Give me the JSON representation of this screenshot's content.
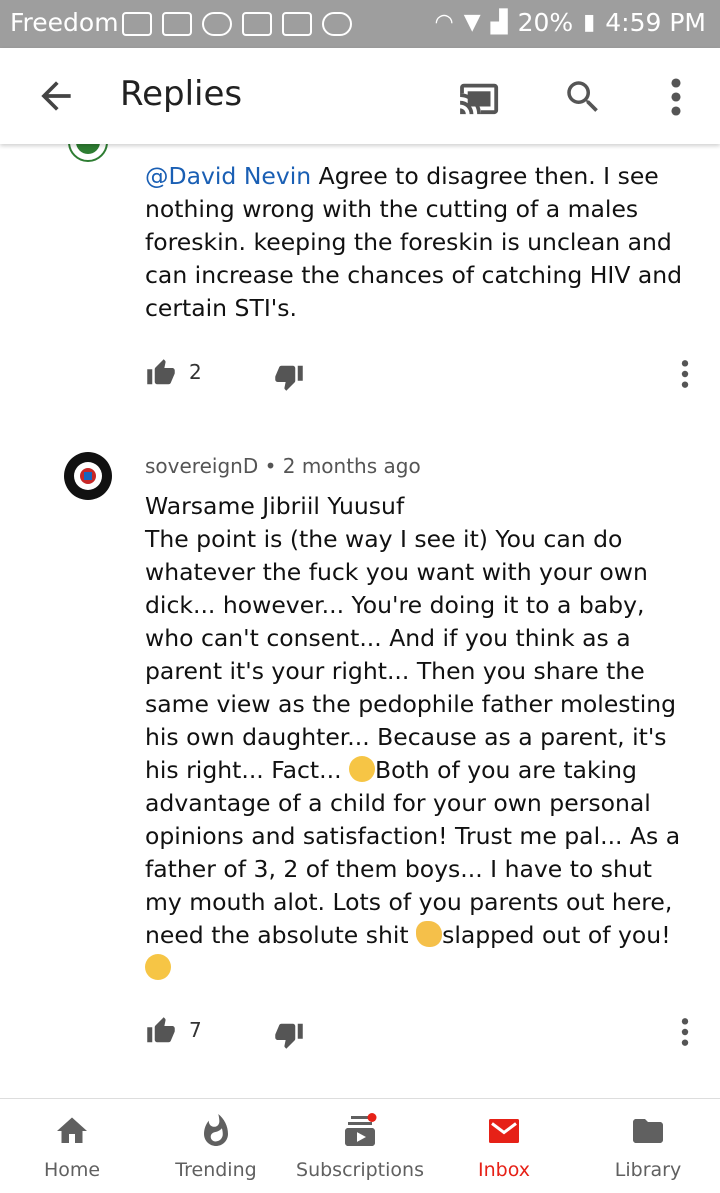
{
  "status_bar": {
    "carrier": "Freedom",
    "battery": "20%",
    "time": "4:59 PM"
  },
  "app_bar": {
    "title": "Replies",
    "icons": [
      "back-icon",
      "cast-icon",
      "search-icon",
      "more-vert-icon"
    ]
  },
  "comments": [
    {
      "mention": "@David Nevin",
      "text": " Agree to disagree then. I see nothing wrong with the cutting of a males foreskin. keeping the foreskin is unclean and can increase the chances of catching HIV and certain STI's.",
      "likes": "2"
    },
    {
      "author": "sovereignD",
      "age": "2 months ago",
      "text_line1": "Warsame Jibriil Yuusuf",
      "text_part1": "The point is (the way I see it) You can do whatever the fuck you want with your own dick... however... You're doing it to a baby, who can't consent... And if you think as a parent it's your right... Then you share the same view as the pedophile father molesting his own daughter... Because as a parent, it's his right... Fact... ",
      "text_part2": "Both of you are taking advantage of a child for your own personal opinions and satisfaction! Trust me pal... As a father of 3, 2 of them boys... I have to shut my mouth alot. Lots of you parents out here, need the absolute shit ",
      "text_part3": "slapped out of you! ",
      "likes": "7"
    }
  ],
  "bottom_nav": [
    {
      "label": "Home",
      "icon": "home-icon"
    },
    {
      "label": "Trending",
      "icon": "trending-flame-icon"
    },
    {
      "label": "Subscriptions",
      "icon": "subscriptions-icon"
    },
    {
      "label": "Inbox",
      "icon": "inbox-mail-icon",
      "active": true
    },
    {
      "label": "Library",
      "icon": "library-folder-icon"
    }
  ],
  "colors": {
    "accent": "#e62117",
    "link": "#1a5fb4",
    "status_bar": "#9e9e9e"
  }
}
